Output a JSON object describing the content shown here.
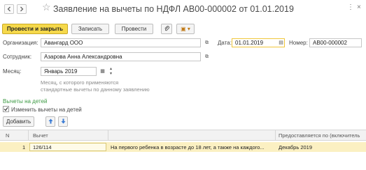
{
  "header": {
    "title": "Заявление на вычеты по НДФЛ АВ00-000002 от 01.01.2019",
    "star": "☆",
    "more": "⋮",
    "close": "×"
  },
  "toolbar": {
    "post_close": "Провести и закрыть",
    "save": "Записать",
    "post": "Провести",
    "attach": "🔗",
    "docs": "▣ ▾"
  },
  "form": {
    "org_label": "Организация:",
    "org_value": "Авангард ООО",
    "date_label": "Дата:",
    "date_value": "01.01.2019",
    "number_label": "Номер:",
    "number_value": "АВ00-000002",
    "employee_label": "Сотрудник:",
    "employee_value": "Азарова Анна Александровна",
    "month_label": "Месяц:",
    "month_value": "Январь 2019",
    "hint_line1": "Месяц, с которого применяются",
    "hint_line2": "стандартные вычеты по данному заявлению"
  },
  "deductions": {
    "section_title": "Вычеты на детей",
    "change_checkbox_label": "Изменить вычеты на детей",
    "change_checked": true,
    "add_button": "Добавить",
    "table": {
      "columns": [
        "N",
        "Вычет",
        "",
        "Предоставляется по (включитель"
      ],
      "rows": [
        {
          "n": "1",
          "code": "126/114",
          "description": "На первого ребенка в возрасте до 18 лет, а также на каждого...",
          "until": "Декабрь 2019"
        }
      ]
    }
  }
}
